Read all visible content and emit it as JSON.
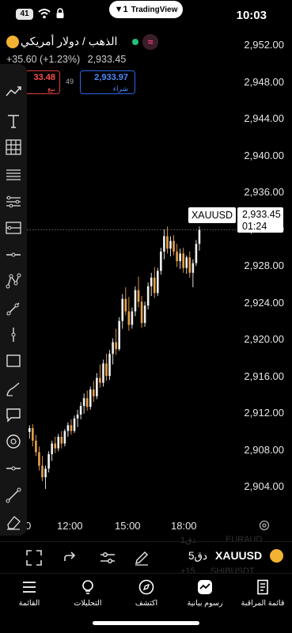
{
  "status_bar": {
    "battery": "41",
    "app_pill": "TradingView",
    "time": "10:03"
  },
  "symbol": {
    "name": "الذهب / دولار أمريكي",
    "change": "+35.60 (+1.23%)",
    "last": "2,933.45",
    "sell_value": "33.48",
    "sell_label": "بيع",
    "spread": "49",
    "buy_value": "2,933.97",
    "buy_label": "شراء"
  },
  "price_axis": {
    "ticks": [
      "2,952.00",
      "2,948.00",
      "2,944.00",
      "2,940.00",
      "2,936.00",
      "2,932.00",
      "2,928.00",
      "2,924.00",
      "2,920.00",
      "2,916.00",
      "2,912.00",
      "2,908.00",
      "2,904.00"
    ]
  },
  "time_axis": {
    "ticks": [
      "0",
      "12:00",
      "15:00",
      "18:00"
    ]
  },
  "chart_overlay": {
    "symbol_tag": "XAUUSD",
    "price_tag": "2,933.45",
    "countdown": "01:24"
  },
  "chart_data": {
    "type": "candlestick",
    "symbol": "XAUUSD",
    "interval": "5دق",
    "ylim": [
      2901.5,
      2954
    ],
    "x_ticks": [
      "12:00",
      "15:00",
      "18:00"
    ],
    "candles": [
      [
        2912.5,
        2913.2,
        2911.8,
        2912.9
      ],
      [
        2912.9,
        2913.3,
        2911.0,
        2911.6
      ],
      [
        2911.6,
        2912.2,
        2910.0,
        2910.4
      ],
      [
        2910.4,
        2911.0,
        2908.5,
        2909.0
      ],
      [
        2909.0,
        2910.0,
        2907.4,
        2907.8
      ],
      [
        2907.8,
        2909.0,
        2906.6,
        2908.7
      ],
      [
        2908.7,
        2910.5,
        2908.3,
        2910.2
      ],
      [
        2910.2,
        2911.6,
        2909.5,
        2911.3
      ],
      [
        2911.3,
        2912.0,
        2910.3,
        2910.8
      ],
      [
        2910.8,
        2912.3,
        2910.5,
        2912.0
      ],
      [
        2912.0,
        2912.6,
        2910.8,
        2911.3
      ],
      [
        2911.3,
        2912.8,
        2911.0,
        2912.6
      ],
      [
        2912.6,
        2913.5,
        2912.0,
        2913.2
      ],
      [
        2913.2,
        2913.8,
        2912.2,
        2912.6
      ],
      [
        2912.6,
        2914.2,
        2912.4,
        2913.9
      ],
      [
        2913.9,
        2914.8,
        2913.0,
        2914.3
      ],
      [
        2914.3,
        2915.6,
        2913.8,
        2915.2
      ],
      [
        2915.2,
        2916.5,
        2914.4,
        2916.0
      ],
      [
        2916.0,
        2916.8,
        2914.7,
        2915.1
      ],
      [
        2915.1,
        2917.2,
        2914.8,
        2916.9
      ],
      [
        2916.9,
        2917.8,
        2915.6,
        2916.2
      ],
      [
        2916.2,
        2918.6,
        2915.9,
        2918.1
      ],
      [
        2918.1,
        2919.5,
        2917.1,
        2917.6
      ],
      [
        2917.6,
        2920.0,
        2917.2,
        2919.6
      ],
      [
        2919.6,
        2920.6,
        2917.8,
        2918.3
      ],
      [
        2918.3,
        2921.0,
        2917.9,
        2920.6
      ],
      [
        2920.6,
        2922.2,
        2919.5,
        2921.8
      ],
      [
        2921.8,
        2923.2,
        2920.5,
        2921.1
      ],
      [
        2921.1,
        2924.4,
        2920.9,
        2924.0
      ],
      [
        2924.0,
        2926.8,
        2923.2,
        2926.3
      ],
      [
        2926.3,
        2927.5,
        2924.6,
        2925.0
      ],
      [
        2925.0,
        2926.5,
        2923.0,
        2923.6
      ],
      [
        2923.6,
        2925.4,
        2923.2,
        2925.0
      ],
      [
        2925.0,
        2927.6,
        2924.5,
        2927.2
      ],
      [
        2927.2,
        2928.6,
        2925.4,
        2926.0
      ],
      [
        2926.0,
        2926.6,
        2923.3,
        2923.8
      ],
      [
        2923.8,
        2926.0,
        2923.4,
        2925.6
      ],
      [
        2925.6,
        2928.0,
        2925.2,
        2927.6
      ],
      [
        2927.6,
        2929.0,
        2926.6,
        2928.5
      ],
      [
        2928.5,
        2929.6,
        2926.4,
        2926.9
      ],
      [
        2926.9,
        2929.5,
        2926.6,
        2929.2
      ],
      [
        2929.2,
        2931.6,
        2928.8,
        2931.2
      ],
      [
        2931.2,
        2933.5,
        2930.4,
        2932.8
      ],
      [
        2932.8,
        2933.8,
        2931.0,
        2931.5
      ],
      [
        2931.5,
        2932.8,
        2930.7,
        2932.3
      ],
      [
        2932.3,
        2932.9,
        2930.8,
        2931.2
      ],
      [
        2931.2,
        2932.0,
        2929.6,
        2930.2
      ],
      [
        2930.2,
        2931.5,
        2929.4,
        2931.0
      ],
      [
        2931.0,
        2931.6,
        2929.0,
        2929.5
      ],
      [
        2929.5,
        2930.8,
        2928.9,
        2930.6
      ],
      [
        2930.6,
        2931.2,
        2928.5,
        2929.0
      ],
      [
        2929.0,
        2930.4,
        2927.5,
        2930.0
      ],
      [
        2930.0,
        2932.4,
        2929.7,
        2932.0
      ],
      [
        2932.0,
        2933.8,
        2931.3,
        2933.45
      ]
    ]
  },
  "controls": {
    "interval": "5دق",
    "ticker": "XAUUSD",
    "ghost_top_left": "1دق",
    "ghost_top_right": "EURAUD",
    "ghost_bottom_left": "+15",
    "ghost_bottom_right": "SHIBUSDT"
  },
  "tabs": [
    {
      "label": "القائمة",
      "icon": "menu-icon"
    },
    {
      "label": "التحليلات",
      "icon": "lightbulb-icon"
    },
    {
      "label": "اكتشف",
      "icon": "compass-icon"
    },
    {
      "label": "رسوم بيانية",
      "icon": "chart-icon"
    },
    {
      "label": "قائمة المراقبة",
      "icon": "watchlist-icon"
    }
  ],
  "colors": {
    "background": "#000000",
    "candle_up": "#f1f1f1",
    "candle_down": "#e8a24a",
    "buy": "#2d63e6",
    "sell": "#e23a3a",
    "live": "#22c27a"
  }
}
